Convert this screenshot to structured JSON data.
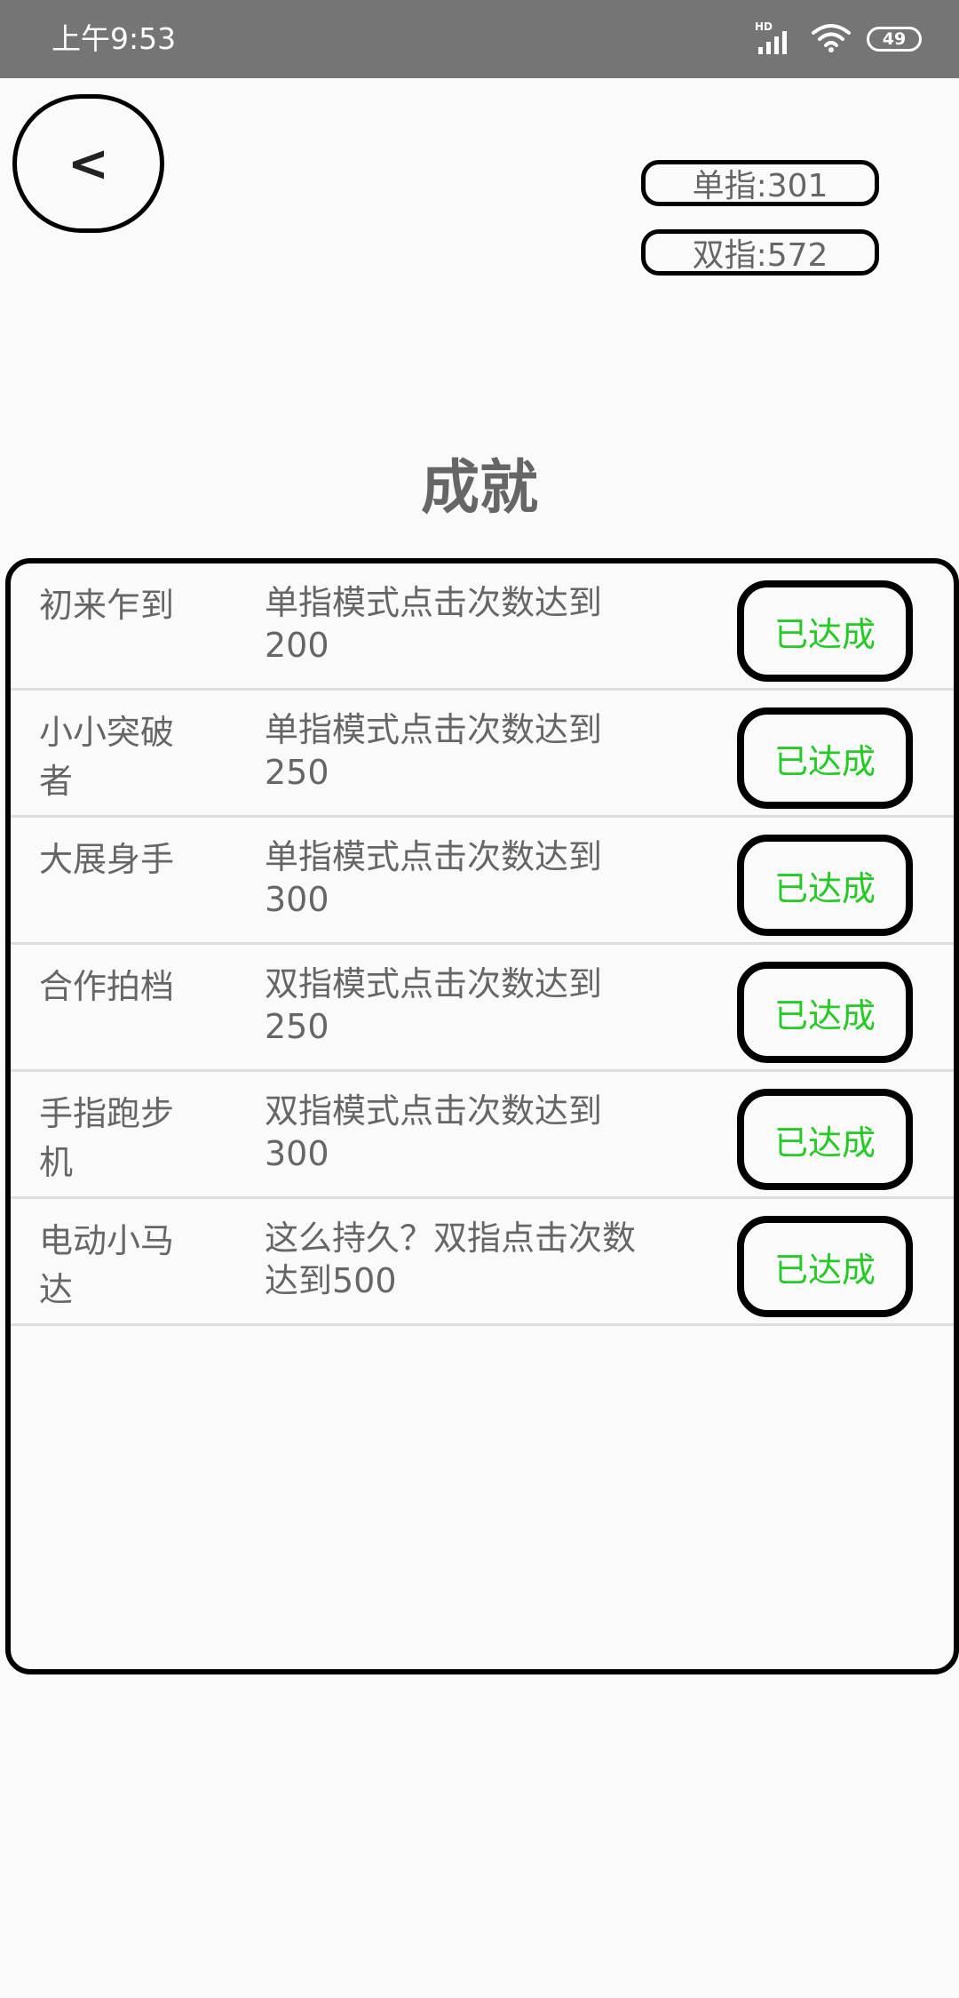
{
  "status_bar": {
    "time": "上午9:53",
    "network_label": "HD",
    "battery": "49",
    "icons": [
      "signal-icon",
      "wifi-icon",
      "battery-icon"
    ]
  },
  "header": {
    "back_label": "<",
    "single_score": "单指:301",
    "double_score": "双指:572"
  },
  "title": "成就",
  "achievements": [
    {
      "name": "初来乍到",
      "description": "单指模式点击次数达到200",
      "status": "已达成"
    },
    {
      "name": "小小突破者",
      "description": "单指模式点击次数达到250",
      "status": "已达成"
    },
    {
      "name": "大展身手",
      "description": "单指模式点击次数达到300",
      "status": "已达成"
    },
    {
      "name": "合作拍档",
      "description": "双指模式点击次数达到250",
      "status": "已达成"
    },
    {
      "name": "手指跑步机",
      "description": "双指模式点击次数达到300",
      "status": "已达成"
    },
    {
      "name": "电动小马达",
      "description": "这么持久？双指点击次数达到500",
      "status": "已达成"
    }
  ],
  "colors": {
    "status_bar": "#757575",
    "background": "#fafafa",
    "text": "#666666",
    "achieved": "#22cc22",
    "border": "#000000"
  }
}
